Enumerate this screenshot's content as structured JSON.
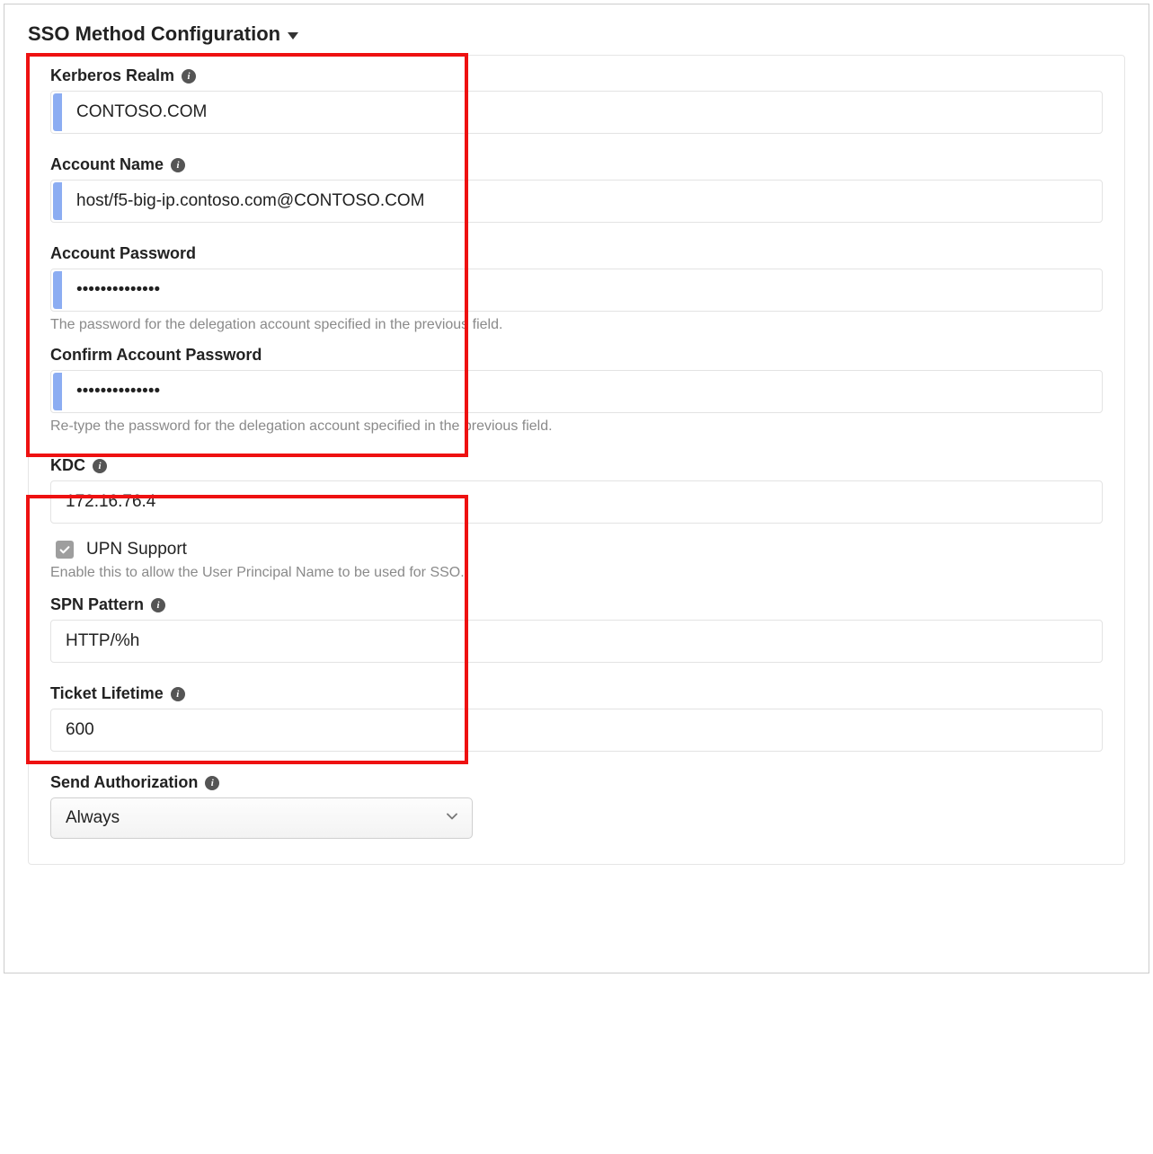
{
  "section": {
    "title": "SSO Method Configuration"
  },
  "fields": {
    "kerberos_realm": {
      "label": "Kerberos Realm",
      "value": "CONTOSO.COM"
    },
    "account_name": {
      "label": "Account Name",
      "value": "host/f5-big-ip.contoso.com@CONTOSO.COM"
    },
    "account_password": {
      "label": "Account Password",
      "value": "••••••••••••••",
      "help": "The password for the delegation account specified in the previous field."
    },
    "confirm_account_password": {
      "label": "Confirm Account Password",
      "value": "••••••••••••••",
      "help": "Re-type the password for the delegation account specified in the previous field."
    },
    "kdc": {
      "label": "KDC",
      "value": "172.16.76.4"
    },
    "upn_support": {
      "label": "UPN Support",
      "checked": true,
      "help": "Enable this to allow the User Principal Name to be used for SSO."
    },
    "spn_pattern": {
      "label": "SPN Pattern",
      "value": "HTTP/%h"
    },
    "ticket_lifetime": {
      "label": "Ticket Lifetime",
      "value": "600"
    },
    "send_authorization": {
      "label": "Send Authorization",
      "value": "Always"
    }
  }
}
